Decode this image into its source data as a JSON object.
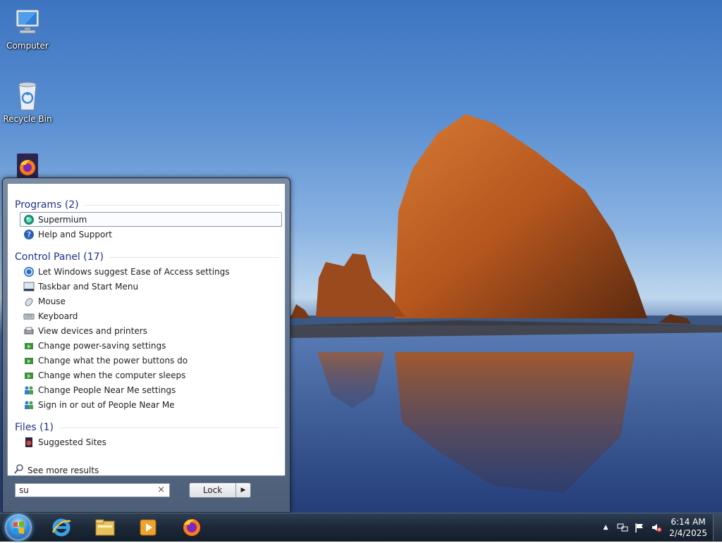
{
  "desktop": {
    "icons": [
      {
        "label": "Computer",
        "icon": "computer-icon"
      },
      {
        "label": "Recycle Bin",
        "icon": "recycle-bin-icon"
      },
      {
        "label": "",
        "icon": "firefox-icon"
      }
    ]
  },
  "start_menu": {
    "programs": {
      "header": "Programs (2)",
      "items": [
        {
          "label": "Supermium",
          "icon": "supermium-icon",
          "selected": true
        },
        {
          "label": "Help and Support",
          "icon": "help-icon"
        }
      ]
    },
    "control_panel": {
      "header": "Control Panel (17)",
      "items": [
        {
          "label": "Let Windows suggest Ease of Access settings",
          "icon": "ease-of-access-icon"
        },
        {
          "label": "Taskbar and Start Menu",
          "icon": "taskbar-icon"
        },
        {
          "label": "Mouse",
          "icon": "mouse-icon"
        },
        {
          "label": "Keyboard",
          "icon": "keyboard-icon"
        },
        {
          "label": "View devices and printers",
          "icon": "devices-printers-icon"
        },
        {
          "label": "Change power-saving settings",
          "icon": "power-options-icon"
        },
        {
          "label": "Change what the power buttons do",
          "icon": "power-options-icon"
        },
        {
          "label": "Change when the computer sleeps",
          "icon": "power-options-icon"
        },
        {
          "label": "Change People Near Me settings",
          "icon": "people-near-me-icon"
        },
        {
          "label": "Sign in or out of People Near Me",
          "icon": "people-near-me-icon"
        }
      ]
    },
    "files": {
      "header": "Files (1)",
      "items": [
        {
          "label": "Suggested Sites",
          "icon": "suggested-sites-icon"
        }
      ]
    },
    "see_more": "See more results",
    "search_value": "su",
    "search_clear": "×",
    "lock_label": "Lock",
    "lock_arrow": "▶"
  },
  "taskbar": {
    "pinned": [
      "internet-explorer-icon",
      "file-explorer-icon",
      "media-player-icon",
      "firefox-icon"
    ],
    "tray": {
      "show_hidden": "▲",
      "icons": [
        "network-icon",
        "action-center-flag-icon",
        "volume-muted-icon"
      ],
      "time": "6:14 AM",
      "date": "2/4/2025"
    }
  },
  "colors": {
    "header_blue": "#1e3287",
    "taskbar": "#1c2838",
    "sky": "#5a8fd2",
    "rock": "#b8581e"
  }
}
